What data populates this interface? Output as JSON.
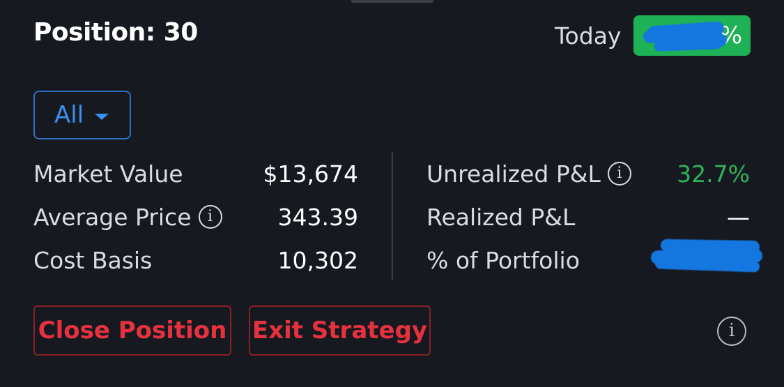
{
  "header": {
    "title": "Position: 30",
    "today_label": "Today",
    "today_badge_suffix": "%"
  },
  "filter": {
    "selected": "All"
  },
  "stats_left": [
    {
      "label": "Market Value",
      "value": "$13,674"
    },
    {
      "label": "Average Price",
      "value": "343.39",
      "has_info": true
    },
    {
      "label": "Cost Basis",
      "value": "10,302"
    }
  ],
  "stats_right": [
    {
      "label": "Unrealized P&L",
      "value": "32.7%",
      "has_info": true
    },
    {
      "label": "Realized P&L",
      "value": "—"
    },
    {
      "label": "% of Portfolio",
      "value": ""
    }
  ],
  "actions": {
    "close_label": "Close Position",
    "exit_label": "Exit Strategy"
  },
  "icons": {
    "info": "info-icon",
    "dropdown": "caret-down-icon"
  },
  "colors": {
    "background": "#161a20",
    "positive": "#2fb35a",
    "badge": "#1fb155",
    "accent": "#3b8ff0",
    "danger": "#e8313f",
    "redaction": "#1477e0"
  }
}
